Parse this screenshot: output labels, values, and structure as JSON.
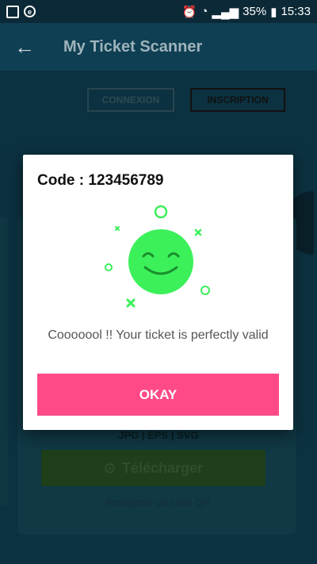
{
  "status_bar": {
    "battery": "35%",
    "time": "15:33"
  },
  "app_bar": {
    "title": "My Ticket Scanner"
  },
  "background": {
    "tab_login": "CONNEXION",
    "tab_signup": "INSCRIPTION",
    "formats": "JPG | EPS | SVG",
    "download_label": "Télécharger",
    "embed_label": "Incorporer un code QR"
  },
  "dialog": {
    "title": "Code : 123456789",
    "message": "Cooooool !! Your ticket is perfectly valid",
    "button_label": "OKAY",
    "accent_color": "#ff4a87",
    "smiley_color": "#3cf05a",
    "illustration_icon": "smiley-face-icon"
  }
}
